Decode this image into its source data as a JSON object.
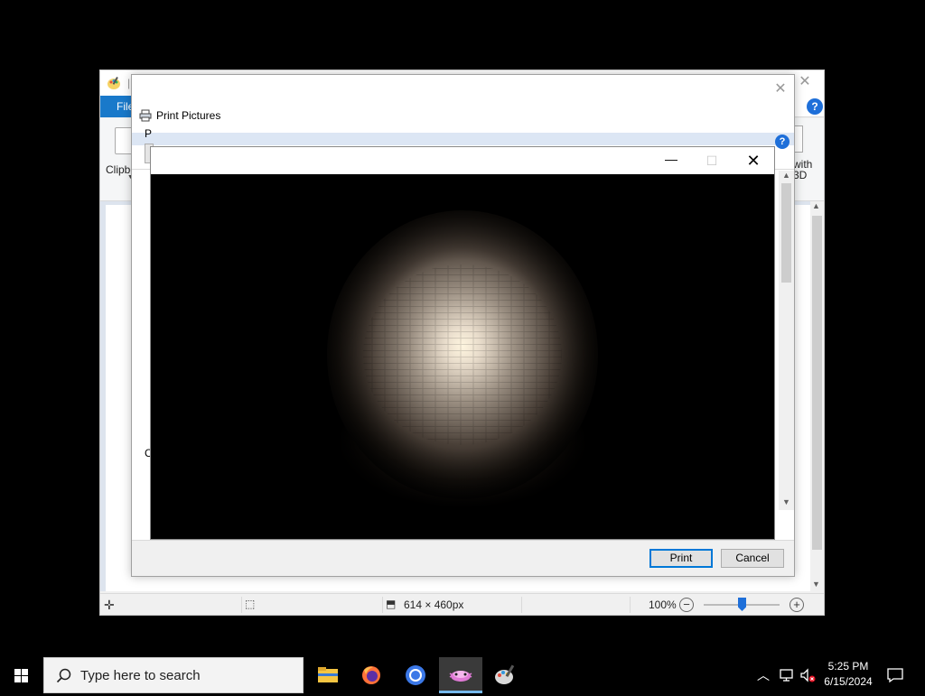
{
  "paint": {
    "file_tab": "File",
    "clipboard_label": "Clipboard",
    "edit3d_line1": "with",
    "edit3d_line2": "3D",
    "status": {
      "image_size": "614 × 460px",
      "zoom": "100%"
    }
  },
  "print_dialog": {
    "title": "Print Pictures",
    "printer_label": "P",
    "copies_label": "C",
    "print_button": "Print",
    "cancel_button": "Cancel"
  },
  "preview_window": {
    "image_description": "dark brick tunnel lit by a flashlight"
  },
  "taskbar": {
    "search_placeholder": "Type here to search",
    "time": "5:25 PM",
    "date": "6/15/2024",
    "pinned_apps": [
      "file-explorer",
      "firefox",
      "chrome",
      "active-app",
      "paint"
    ]
  },
  "colors": {
    "accent": "#0078d7",
    "file_tab": "#1979ca",
    "taskbar": "#000000"
  }
}
